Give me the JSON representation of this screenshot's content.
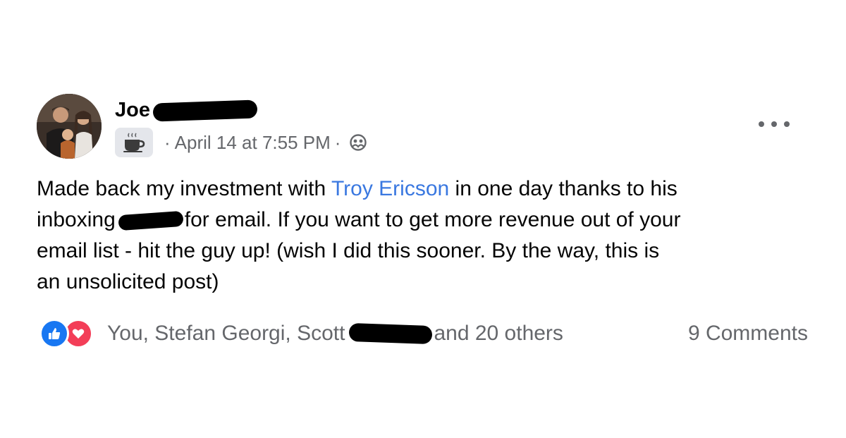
{
  "post": {
    "author": {
      "first_name": "Joe"
    },
    "meta": {
      "date": "April 14 at 7:55 PM",
      "separator": "·",
      "badge_icon": "coffee-cup-icon",
      "privacy_icon": "people-icon"
    },
    "text": {
      "line1_before": "Made back my investment with ",
      "mention": "Troy Ericson",
      "line1_after": " in one day thanks to his",
      "line2_before": "inboxing",
      "line2_after": "for email. If you want to get more revenue out of your",
      "line3": "email list - hit the guy up! (wish I did this sooner. By the way, this is",
      "line4": "an unsolicited post)"
    },
    "reactions": {
      "icons": [
        "like-icon",
        "love-icon"
      ],
      "likers_prefix": "You, Stefan Georgi, Scott",
      "likers_suffix": "and 20 others",
      "comments": "9 Comments"
    },
    "colors": {
      "mention": "#3a78e0",
      "muted": "#65676b",
      "like": "#1877f2",
      "love": "#f33e58"
    }
  }
}
